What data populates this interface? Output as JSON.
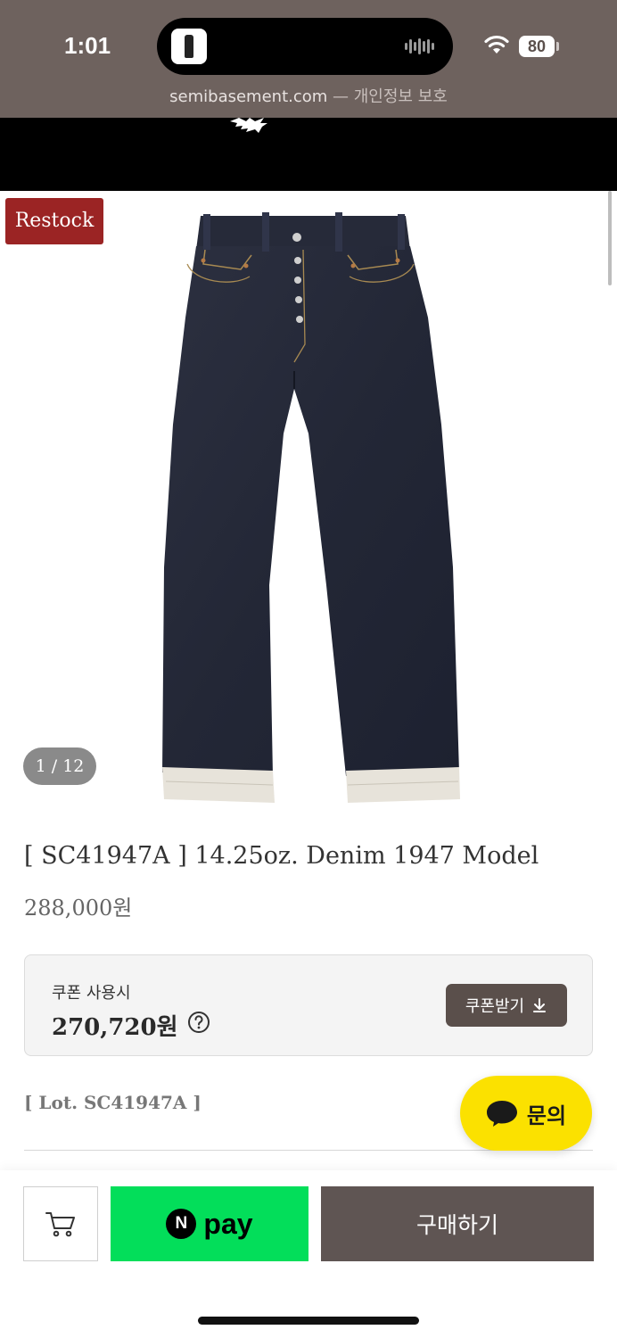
{
  "status_bar": {
    "time": "1:01",
    "battery": "80"
  },
  "browser": {
    "domain": "semibasement.com",
    "separator": " — ",
    "privacy": "개인정보 보호"
  },
  "product": {
    "badge": "Restock",
    "image_counter": "1 / 12",
    "title": "[ SC41947A ] 14.25oz. Denim 1947 Model",
    "price": "288,000원",
    "lot": "[ Lot. SC41947A ]"
  },
  "coupon": {
    "label": "쿠폰 사용시",
    "price": "270,720원",
    "button_label": "쿠폰받기"
  },
  "inquiry": {
    "label": "문의"
  },
  "bottom_bar": {
    "npay_letter": "N",
    "npay_text": "pay",
    "buy_label": "구매하기"
  },
  "colors": {
    "status_bg": "#6e625e",
    "restock_badge": "#9b2424",
    "npay_green": "#03de5a",
    "buy_button": "#5f5553",
    "kakao_yellow": "#fbe100"
  },
  "icons": [
    "lipstick-app-icon",
    "audio-wave-icon",
    "wifi-icon",
    "help-circle-icon",
    "download-icon",
    "chat-bubble-icon",
    "cart-icon"
  ]
}
